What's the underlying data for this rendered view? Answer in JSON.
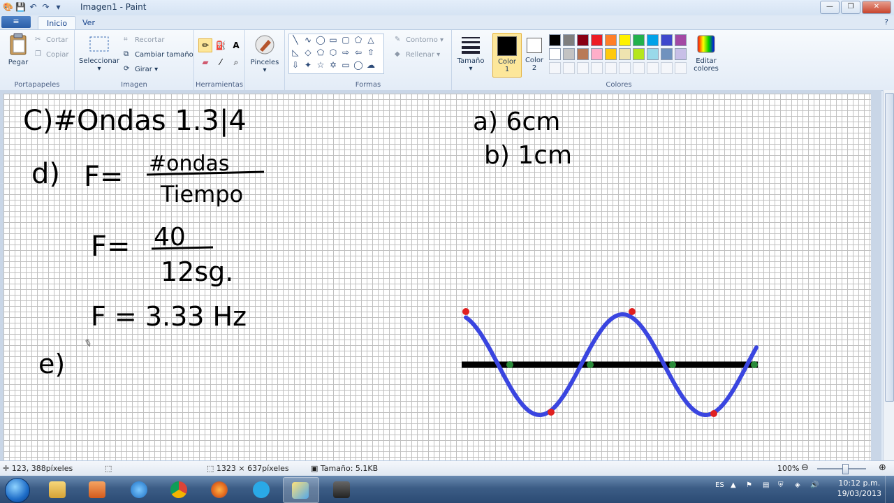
{
  "window": {
    "title": "Imagen1 - Paint"
  },
  "tabs": {
    "file": "≡",
    "inicio": "Inicio",
    "ver": "Ver"
  },
  "ribbon": {
    "portapapeles": {
      "label": "Portapapeles",
      "paste": "Pegar",
      "cut": "Cortar",
      "copy": "Copiar"
    },
    "imagen": {
      "label": "Imagen",
      "select": "Seleccionar",
      "crop": "Recortar",
      "resize": "Cambiar tamaño",
      "rotate": "Girar"
    },
    "herramientas": {
      "label": "Herramientas"
    },
    "pinceles": {
      "label": "Pinceles"
    },
    "formas": {
      "label": "Formas",
      "outline": "Contorno",
      "fill": "Rellenar"
    },
    "tamano": {
      "label": "Tamaño"
    },
    "color1": {
      "line1": "Color",
      "line2": "1"
    },
    "color2": {
      "line1": "Color",
      "line2": "2"
    },
    "colores": {
      "label": "Colores",
      "edit_line1": "Editar",
      "edit_line2": "colores"
    }
  },
  "palette": {
    "row1": [
      "#000000",
      "#7f7f7f",
      "#880015",
      "#ed1c24",
      "#ff7f27",
      "#fff200",
      "#22b14c",
      "#00a2e8",
      "#3f48cc",
      "#a349a4"
    ],
    "row2": [
      "#ffffff",
      "#c3c3c3",
      "#b97a57",
      "#ffaec9",
      "#ffc90e",
      "#efe4b0",
      "#b5e61d",
      "#99d9ea",
      "#7092be",
      "#c8bfe7"
    ]
  },
  "colors": {
    "color1": "#000000",
    "color2": "#ffffff",
    "wave": "#3a45e0",
    "peak": "#e02020",
    "node": "#2a8a3a"
  },
  "drawing": {
    "line_c": "C)#Ondas 1.3|4",
    "line_a": "a) 6cm",
    "line_b": "b) 1cm",
    "line_d": "d)",
    "formula_f1": "F=",
    "numerator1": "#ondas",
    "denominator1": "Tiempo",
    "formula_f2": "F=",
    "numerator2": "40",
    "denominator2": "12sg.",
    "result": "F = 3.33 Hz",
    "line_e": "e)"
  },
  "status": {
    "cursor": "123, 388píxeles",
    "dimensions": "1323 × 637píxeles",
    "size": "Tamaño: 5.1KB",
    "zoom": "100%"
  },
  "taskbar": {
    "lang": "ES",
    "time": "10:12 p.m.",
    "date": "19/03/2013"
  }
}
